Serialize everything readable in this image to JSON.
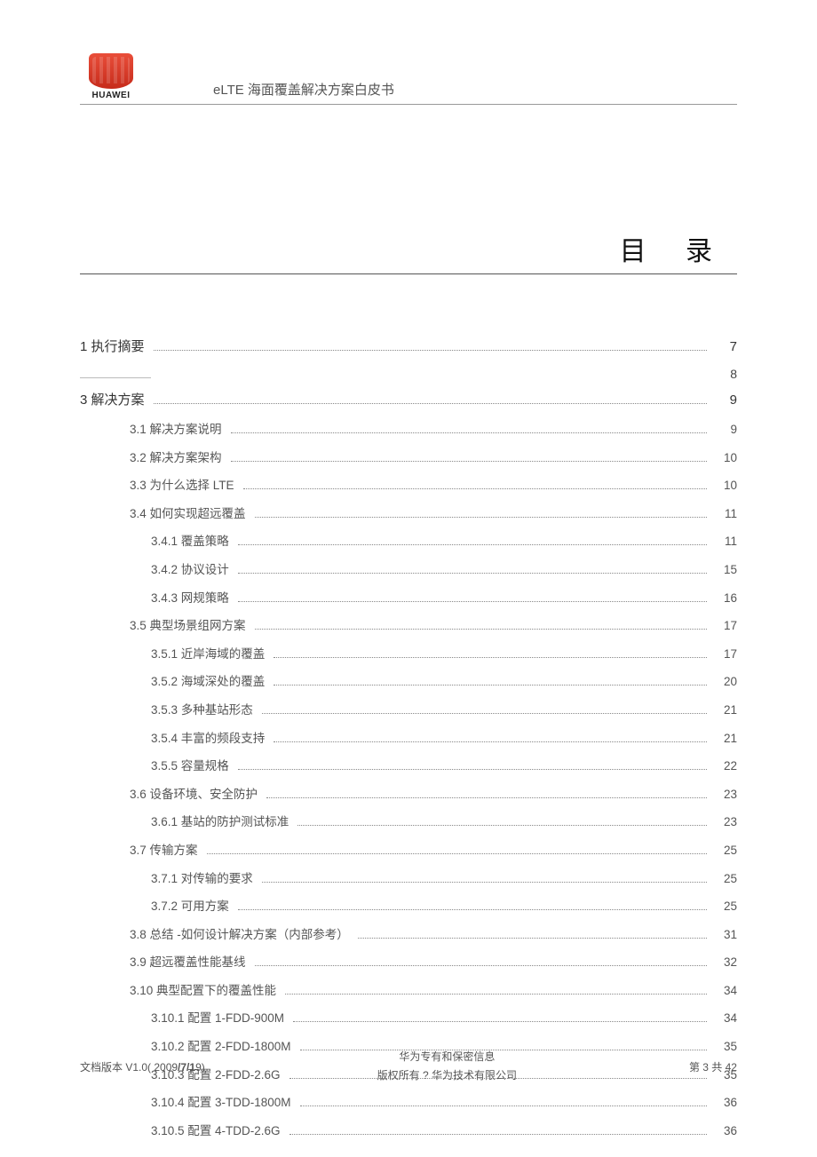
{
  "header": {
    "logo_text": "HUAWEI",
    "doc_title": "eLTE 海面覆盖解决方案白皮书"
  },
  "section_title": "目 录",
  "toc": [
    {
      "level": 0,
      "label": "1 执行摘要",
      "page": "7"
    },
    {
      "level": "tiny",
      "label": "",
      "page": "8"
    },
    {
      "level": 0,
      "label": "3 解决方案",
      "page": "9"
    },
    {
      "level": 1,
      "label": "3.1  解决方案说明",
      "page": "9"
    },
    {
      "level": 1,
      "label": "3.2  解决方案架构",
      "page": "10"
    },
    {
      "level": 1,
      "label": "3.3  为什么选择 LTE",
      "page": "10"
    },
    {
      "level": 1,
      "label": "3.4  如何实现超远覆盖",
      "page": "11"
    },
    {
      "level": 2,
      "label": "3.4.1  覆盖策略",
      "page": "11"
    },
    {
      "level": 2,
      "label": "3.4.2  协议设计",
      "page": "15"
    },
    {
      "level": 2,
      "label": "3.4.3  网规策略",
      "page": "16"
    },
    {
      "level": 1,
      "label": "3.5  典型场景组网方案",
      "page": "17"
    },
    {
      "level": 2,
      "label": "3.5.1  近岸海域的覆盖",
      "page": "17"
    },
    {
      "level": 2,
      "label": "3.5.2  海域深处的覆盖",
      "page": "20"
    },
    {
      "level": 2,
      "label": "3.5.3  多种基站形态",
      "page": "21"
    },
    {
      "level": 2,
      "label": "3.5.4  丰富的频段支持",
      "page": "21"
    },
    {
      "level": 2,
      "label": "3.5.5  容量规格",
      "page": "22"
    },
    {
      "level": 1,
      "label": "3.6  设备环境、安全防护",
      "page": "23"
    },
    {
      "level": 2,
      "label": "3.6.1  基站的防护测试标准",
      "page": "23"
    },
    {
      "level": 1,
      "label": "3.7  传输方案",
      "page": "25"
    },
    {
      "level": 2,
      "label": "3.7.1  对传输的要求",
      "page": "25"
    },
    {
      "level": 2,
      "label": "3.7.2  可用方案",
      "page": "25"
    },
    {
      "level": 1,
      "label": "3.8  总结 -如何设计解决方案（内部参考）",
      "page": "31"
    },
    {
      "level": 1,
      "label": "3.9  超远覆盖性能基线",
      "page": "32"
    },
    {
      "level": 1,
      "label": "3.10 典型配置下的覆盖性能",
      "page": "34"
    },
    {
      "level": 2,
      "label": "3.10.1 配置 1-FDD-900M",
      "page": "34"
    },
    {
      "level": 2,
      "label": "3.10.2 配置 2-FDD-1800M",
      "page": "35"
    },
    {
      "level": 2,
      "label": "3.10.3 配置 2-FDD-2.6G",
      "page": "35"
    },
    {
      "level": 2,
      "label": "3.10.4 配置 3-TDD-1800M",
      "page": "36"
    },
    {
      "level": 2,
      "label": "3.10.5 配置 4-TDD-2.6G",
      "page": "36"
    }
  ],
  "footer": {
    "version_prefix": "文档版本  V1.0( 2009",
    "version_bold": "/7/1",
    "version_suffix": "9)",
    "center_line1": "华为专有和保密信息",
    "center_line2": "版权所有    ? 华为技术有限公司",
    "page_info": "第 3 共 42"
  }
}
